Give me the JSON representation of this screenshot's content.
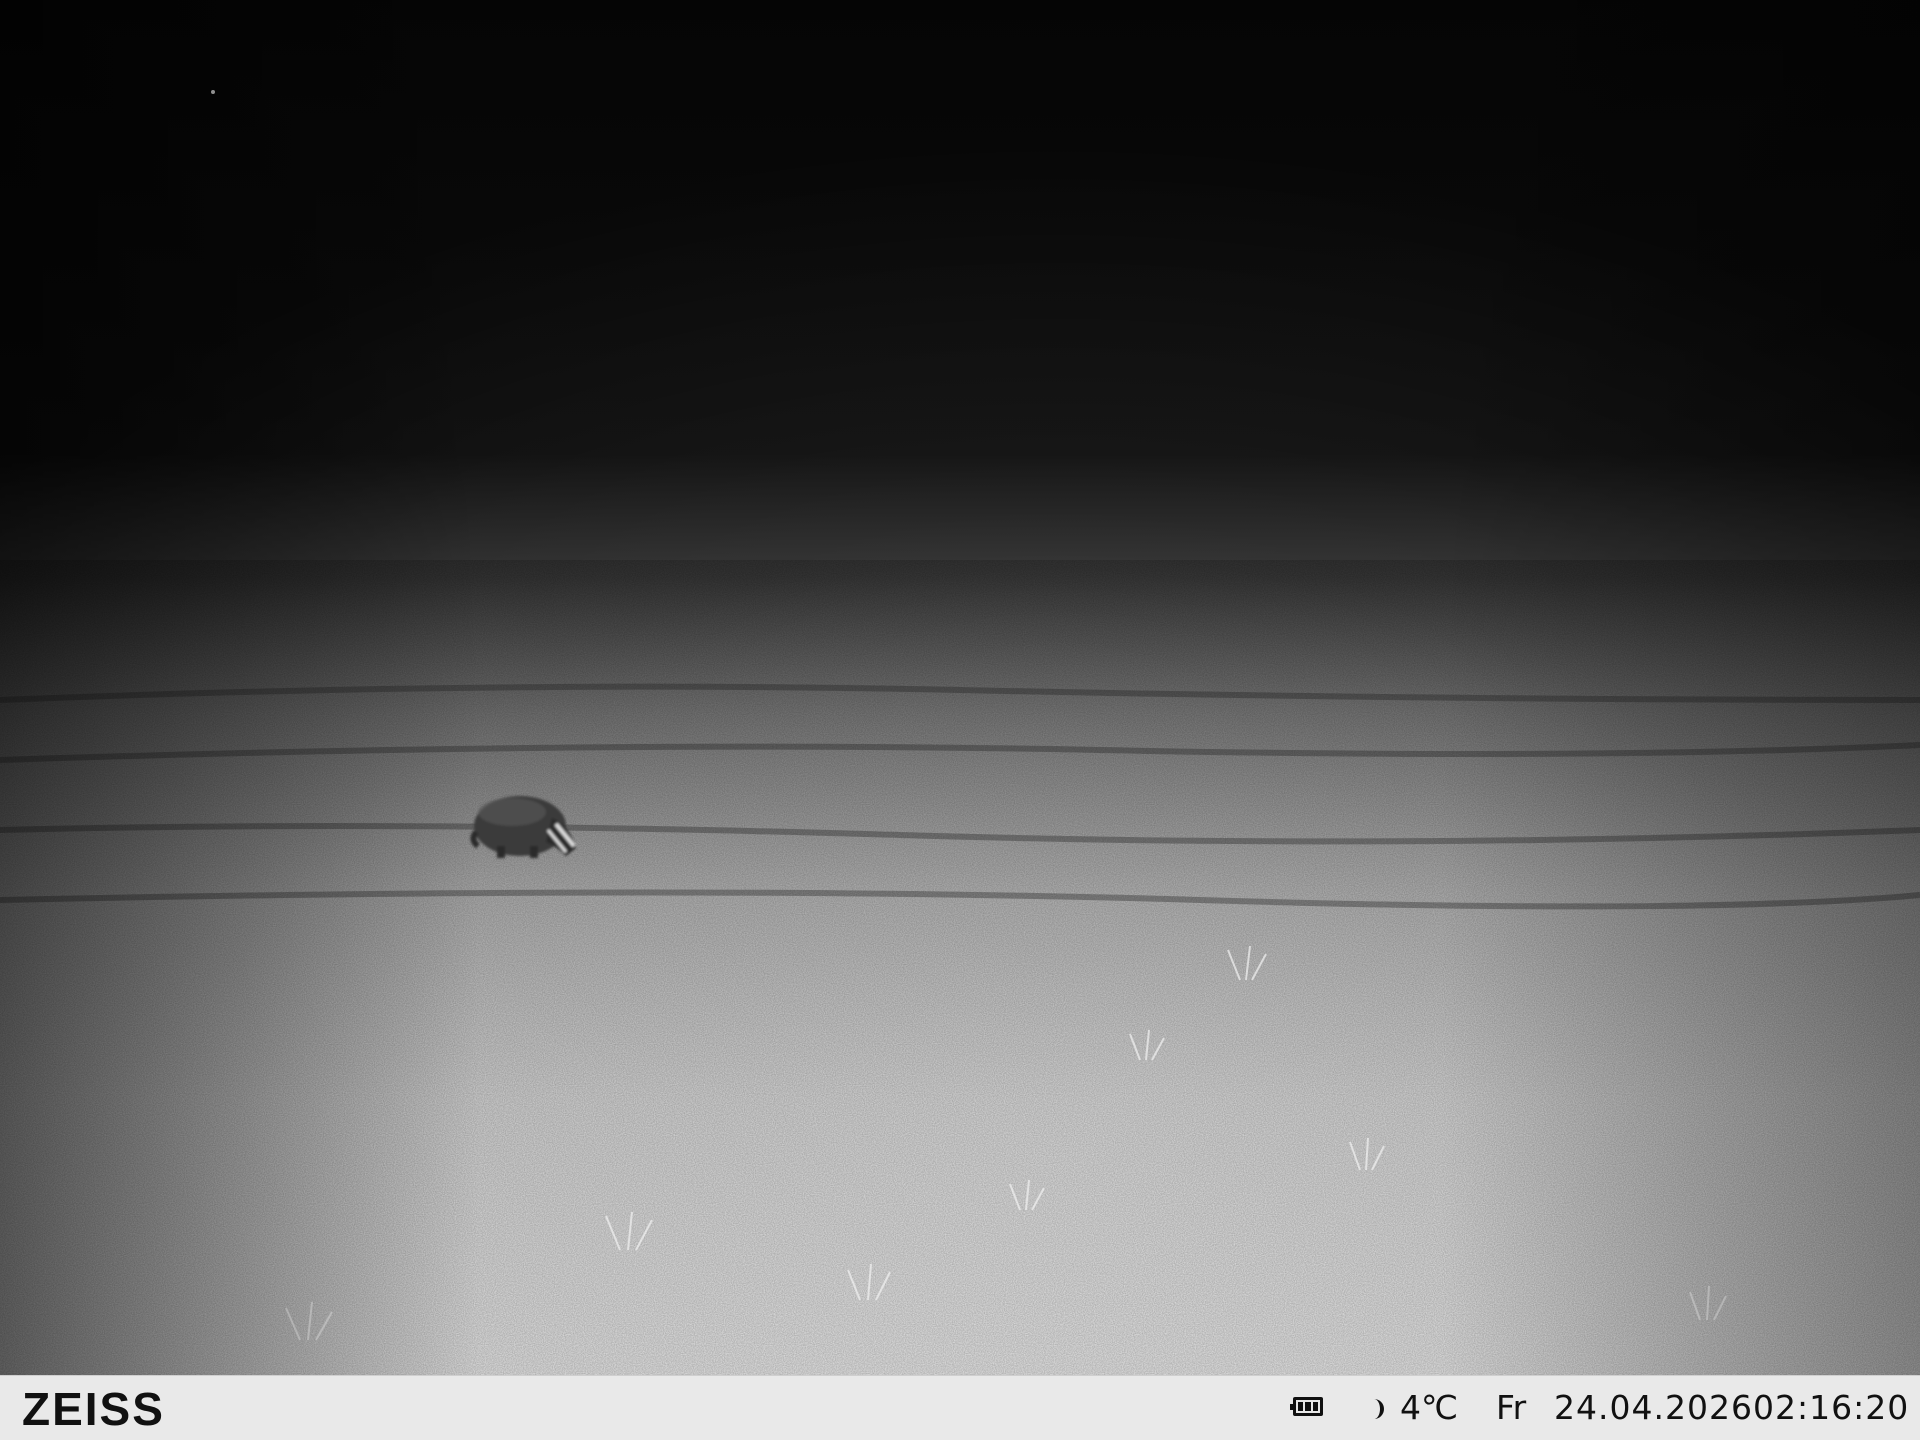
{
  "scene": {
    "description_icon": "trail-camera-night-infrared-photo",
    "subject_icon": "badger-icon",
    "tones": {
      "sky": "#050505",
      "ground_far": "#2a2a2a",
      "ground_near": "#d8d8d8",
      "animal": "#3a3a3a"
    }
  },
  "info_bar": {
    "brand": "ZEISS",
    "battery_icon": "battery-icon",
    "moon_icon": "moon-phase-icon",
    "temperature": "4℃",
    "weekday": "Fr",
    "date": "24.04.2026",
    "time": "02:16:20",
    "background": "#e9e9e9"
  }
}
